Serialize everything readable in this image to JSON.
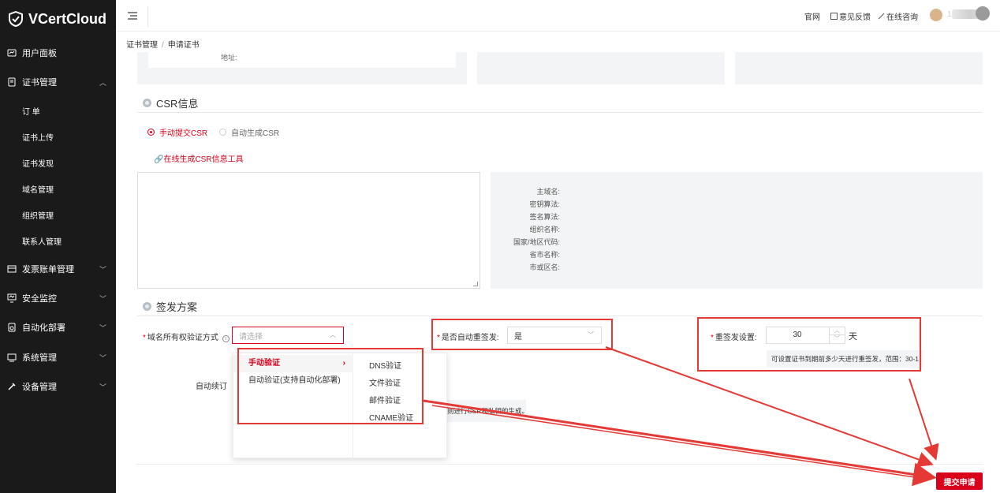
{
  "app": {
    "name": "VCertCloud"
  },
  "sidebar": {
    "items": [
      {
        "label": "用户面板",
        "icon": "dashboard-icon"
      },
      {
        "label": "证书管理",
        "icon": "certificate-icon",
        "expanded": true
      },
      {
        "label": "发票账单管理",
        "icon": "invoice-icon"
      },
      {
        "label": "安全监控",
        "icon": "monitor-icon"
      },
      {
        "label": "自动化部署",
        "icon": "deploy-icon"
      },
      {
        "label": "系统管理",
        "icon": "system-icon"
      },
      {
        "label": "设备管理",
        "icon": "device-icon"
      }
    ],
    "subitems": [
      "订 单",
      "证书上传",
      "证书发现",
      "域名管理",
      "组织管理",
      "联系人管理"
    ]
  },
  "header": {
    "links": [
      "官网",
      "意见反馈",
      "在线咨询"
    ],
    "user_suffix": "1"
  },
  "breadcrumb": {
    "parent": "证书管理",
    "current": "申请证书"
  },
  "address_label": "地址:",
  "csr": {
    "section_title": "CSR信息",
    "radio_manual": "手动提交CSR",
    "radio_auto": "自动生成CSR",
    "tool_link": "在线生成CSR信息工具",
    "fields": [
      "主域名:",
      "密钥算法:",
      "签名算法:",
      "组织名称:",
      "国家/地区代码:",
      "省市名称:",
      "市或区名:"
    ]
  },
  "issuance": {
    "section_title": "签发方案",
    "domain_verify_label": "域名所有权验证方式",
    "domain_verify_placeholder": "请选择",
    "auto_reissue_label": "是否自动重签发:",
    "auto_reissue_value": "是",
    "reissue_setting_label": "重签发设置:",
    "reissue_days": "30",
    "reissue_unit": "天",
    "reissue_hint": "可设置证书到期前多少天进行重签发，范围：30-1",
    "auto_renew_label": "自动续订",
    "partial_hint": "则进行CSR和私钥的生成。"
  },
  "cascader": {
    "options": [
      "手动验证",
      "自动验证(支持自动化部署)"
    ],
    "sub_options": [
      "DNS验证",
      "文件验证",
      "邮件验证",
      "CNAME验证"
    ]
  },
  "submit_label": "提交申请",
  "colors": {
    "brand_red": "#d9001b",
    "sidebar_bg": "#1a1a1a",
    "annotation_red": "#e53935"
  }
}
